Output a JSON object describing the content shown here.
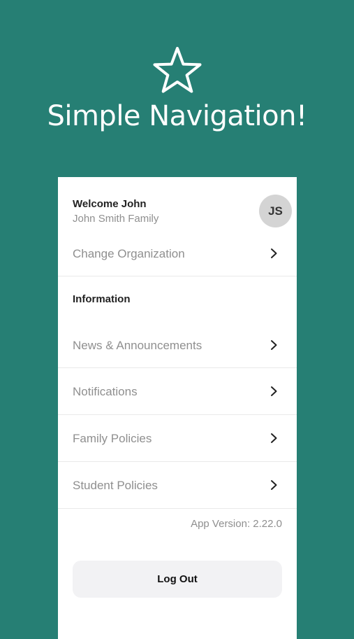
{
  "hero": {
    "icon": "star-outline-icon",
    "title": "Simple Navigation!"
  },
  "colors": {
    "background": "#267f74",
    "panel": "#ffffff",
    "avatar": "#d4d4d4",
    "logout_button": "#f2f2f4"
  },
  "user": {
    "welcome": "Welcome John",
    "family": "John Smith Family",
    "initials": "JS"
  },
  "menu": {
    "change_org": "Change Organization",
    "section_title": "Information",
    "items": [
      {
        "label": "News & Announcements",
        "icon": "chevron-right-icon"
      },
      {
        "label": "Notifications",
        "icon": "chevron-right-icon"
      },
      {
        "label": "Family Policies",
        "icon": "chevron-right-icon"
      },
      {
        "label": "Student Policies",
        "icon": "chevron-right-icon"
      }
    ]
  },
  "footer": {
    "version": "App Version: 2.22.0",
    "logout_label": "Log Out"
  }
}
